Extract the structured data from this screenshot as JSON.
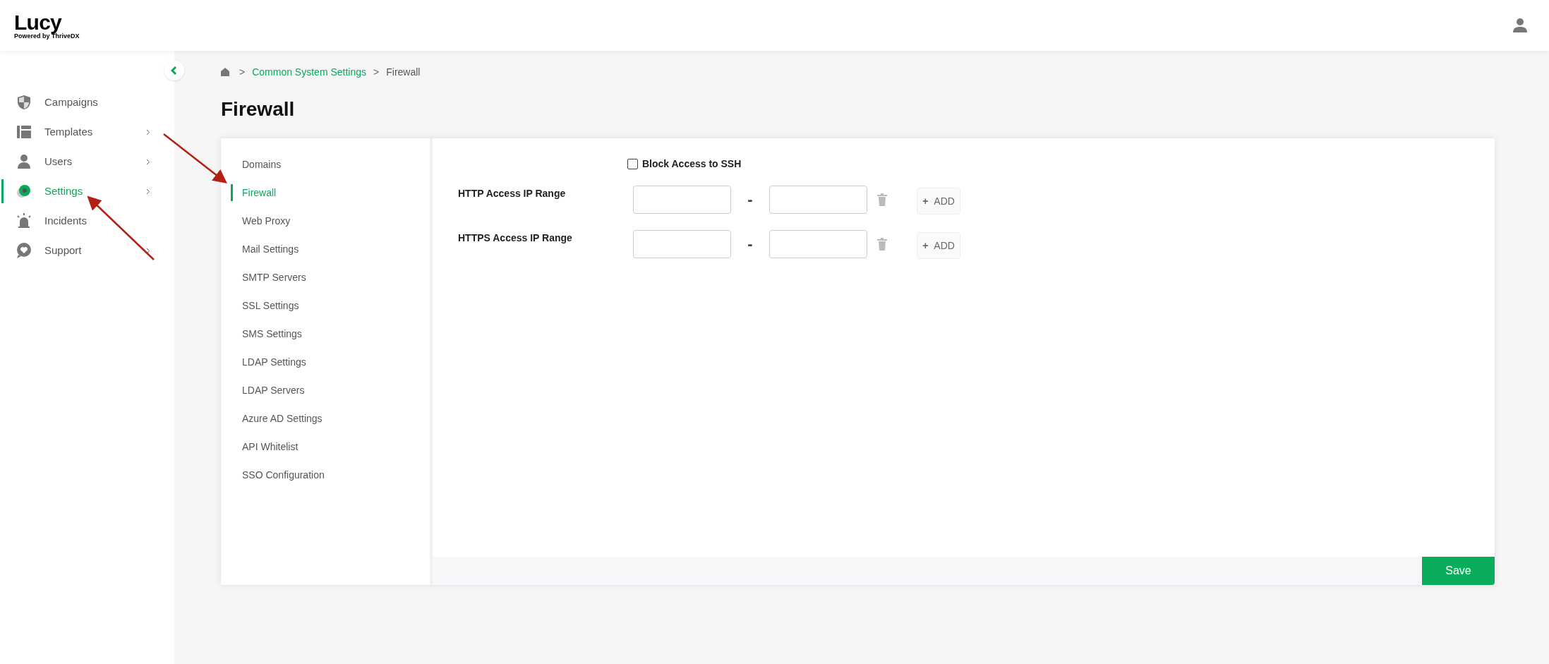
{
  "logo": {
    "title": "Lucy",
    "subtitle": "Powered by ThriveDX"
  },
  "sidebar": {
    "items": [
      {
        "label": "Campaigns",
        "has_submenu": false,
        "selected": false
      },
      {
        "label": "Templates",
        "has_submenu": true,
        "selected": false
      },
      {
        "label": "Users",
        "has_submenu": true,
        "selected": false
      },
      {
        "label": "Settings",
        "has_submenu": true,
        "selected": true
      },
      {
        "label": "Incidents",
        "has_submenu": false,
        "selected": false
      },
      {
        "label": "Support",
        "has_submenu": true,
        "selected": false
      }
    ]
  },
  "breadcrumb": [
    {
      "label": ">",
      "kind": "separator"
    },
    {
      "label": "Common System Settings",
      "kind": "link"
    },
    {
      "label": ">",
      "kind": "separator"
    },
    {
      "label": "Firewall",
      "kind": "current"
    }
  ],
  "page_title": "Firewall",
  "tabs": [
    {
      "label": "Domains",
      "selected": false
    },
    {
      "label": "Firewall",
      "selected": true
    },
    {
      "label": "Web Proxy",
      "selected": false
    },
    {
      "label": "Mail Settings",
      "selected": false
    },
    {
      "label": "SMTP Servers",
      "selected": false
    },
    {
      "label": "SSL Settings",
      "selected": false
    },
    {
      "label": "SMS Settings",
      "selected": false
    },
    {
      "label": "LDAP Settings",
      "selected": false
    },
    {
      "label": "LDAP Servers",
      "selected": false
    },
    {
      "label": "Azure AD Settings",
      "selected": false
    },
    {
      "label": "API Whitelist",
      "selected": false
    },
    {
      "label": "SSO Configuration",
      "selected": false
    }
  ],
  "form": {
    "block_ssh": {
      "label": "Block Access to SSH",
      "checked": false
    },
    "ranges": [
      {
        "label": "HTTP Access IP Range",
        "separator": "-",
        "add": "ADD",
        "add_icon": "+"
      },
      {
        "label": "HTTPS Access IP Range",
        "separator": "-",
        "add": "ADD",
        "add_icon": "+"
      }
    ]
  },
  "save_button": "Save"
}
